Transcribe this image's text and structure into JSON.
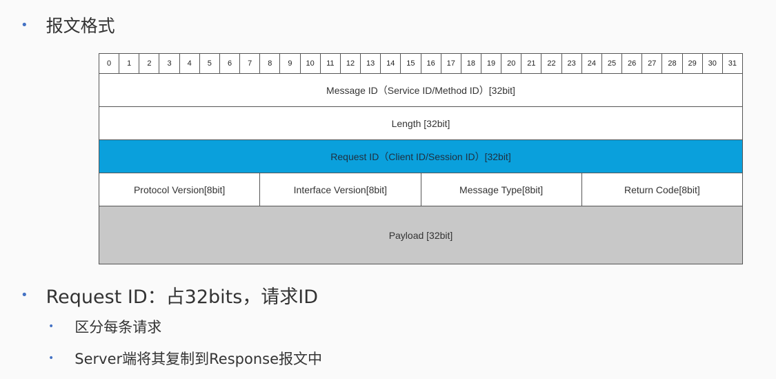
{
  "heading": {
    "bullet": "•",
    "text": "报文格式"
  },
  "diagram": {
    "bits": [
      "0",
      "1",
      "2",
      "3",
      "4",
      "5",
      "6",
      "7",
      "8",
      "9",
      "10",
      "11",
      "12",
      "13",
      "14",
      "15",
      "16",
      "17",
      "18",
      "19",
      "20",
      "21",
      "22",
      "23",
      "24",
      "25",
      "26",
      "27",
      "28",
      "29",
      "30",
      "31"
    ],
    "message_id": "Message ID（Service ID/Method ID）[32bit]",
    "length": "Length [32bit]",
    "request_id": "Request ID（Client ID/Session ID）[32bit]",
    "protocol_version": "Protocol Version[8bit]",
    "interface_version": "Interface Version[8bit]",
    "message_type": "Message Type[8bit]",
    "return_code": "Return Code[8bit]",
    "payload": "Payload [32bit]",
    "colors": {
      "highlight": "#0aa0dc",
      "payload": "#c8c8c8"
    }
  },
  "bullets": {
    "main": {
      "bullet": "•",
      "text": "Request ID：占32bits，请求ID"
    },
    "sub1": {
      "bullet": "•",
      "text": "区分每条请求"
    },
    "sub2": {
      "bullet": "•",
      "text": "Server端将其复制到Response报文中"
    }
  }
}
